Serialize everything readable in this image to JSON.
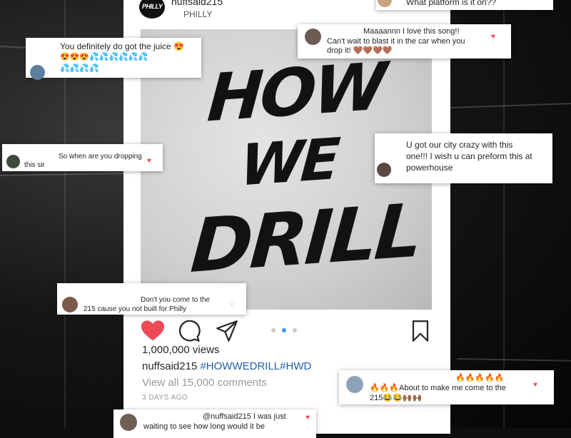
{
  "post": {
    "username": "nuffsaid215",
    "location": "PHILLY",
    "avatar_text": "PHILLY",
    "artwork": {
      "line1": "HOW",
      "line2": "WE",
      "line3": "DRILL"
    },
    "views": "1,000,000 views",
    "caption_user": "nuffsaid215",
    "caption_tags": "#HOWWEDRILL#HWD",
    "view_all": "View all 15,000 comments",
    "time_ago": "3 DAYS AGO",
    "colors": {
      "like": "#ed4956",
      "tag": "#1f5fa8",
      "active_dot": "#3897f0"
    },
    "icons": [
      "heart-filled-icon",
      "comment-icon",
      "share-icon",
      "bookmark-icon"
    ],
    "carousel": {
      "count": 3,
      "active_index": 1
    }
  },
  "comments": {
    "platform": {
      "text": "What platform is it on??"
    },
    "juice": {
      "line1": "You definitely do got the juice 😍",
      "line2": "😍😍😍💦💦💦💦💦💦",
      "line3": "💦💦💦💦"
    },
    "song": {
      "line1": "Maaaannn I love this song!!",
      "line2": "Can't wait to blast it in the car when you",
      "line3": "drop it! 🤎🤎🤎🤎"
    },
    "dropping": {
      "line1": "So when are you dropping",
      "line2": "this sir"
    },
    "city": {
      "line1": "U got our city crazy with this",
      "line2": "one!!! I wish u can preform this at",
      "line3": "powerhouse"
    },
    "philly": {
      "line1": "Don't you come to the",
      "line2": "215 cause you not built for Philly"
    },
    "about": {
      "line1": "🔥🔥🔥🔥🔥",
      "line2": "🔥🔥🔥About to make me come to the",
      "line3": "215😂😂🙌🏾🙌🏾"
    },
    "waiting": {
      "line1": "@nuffsaid215 I was just",
      "line2": "waiting to see how long would it be"
    }
  }
}
